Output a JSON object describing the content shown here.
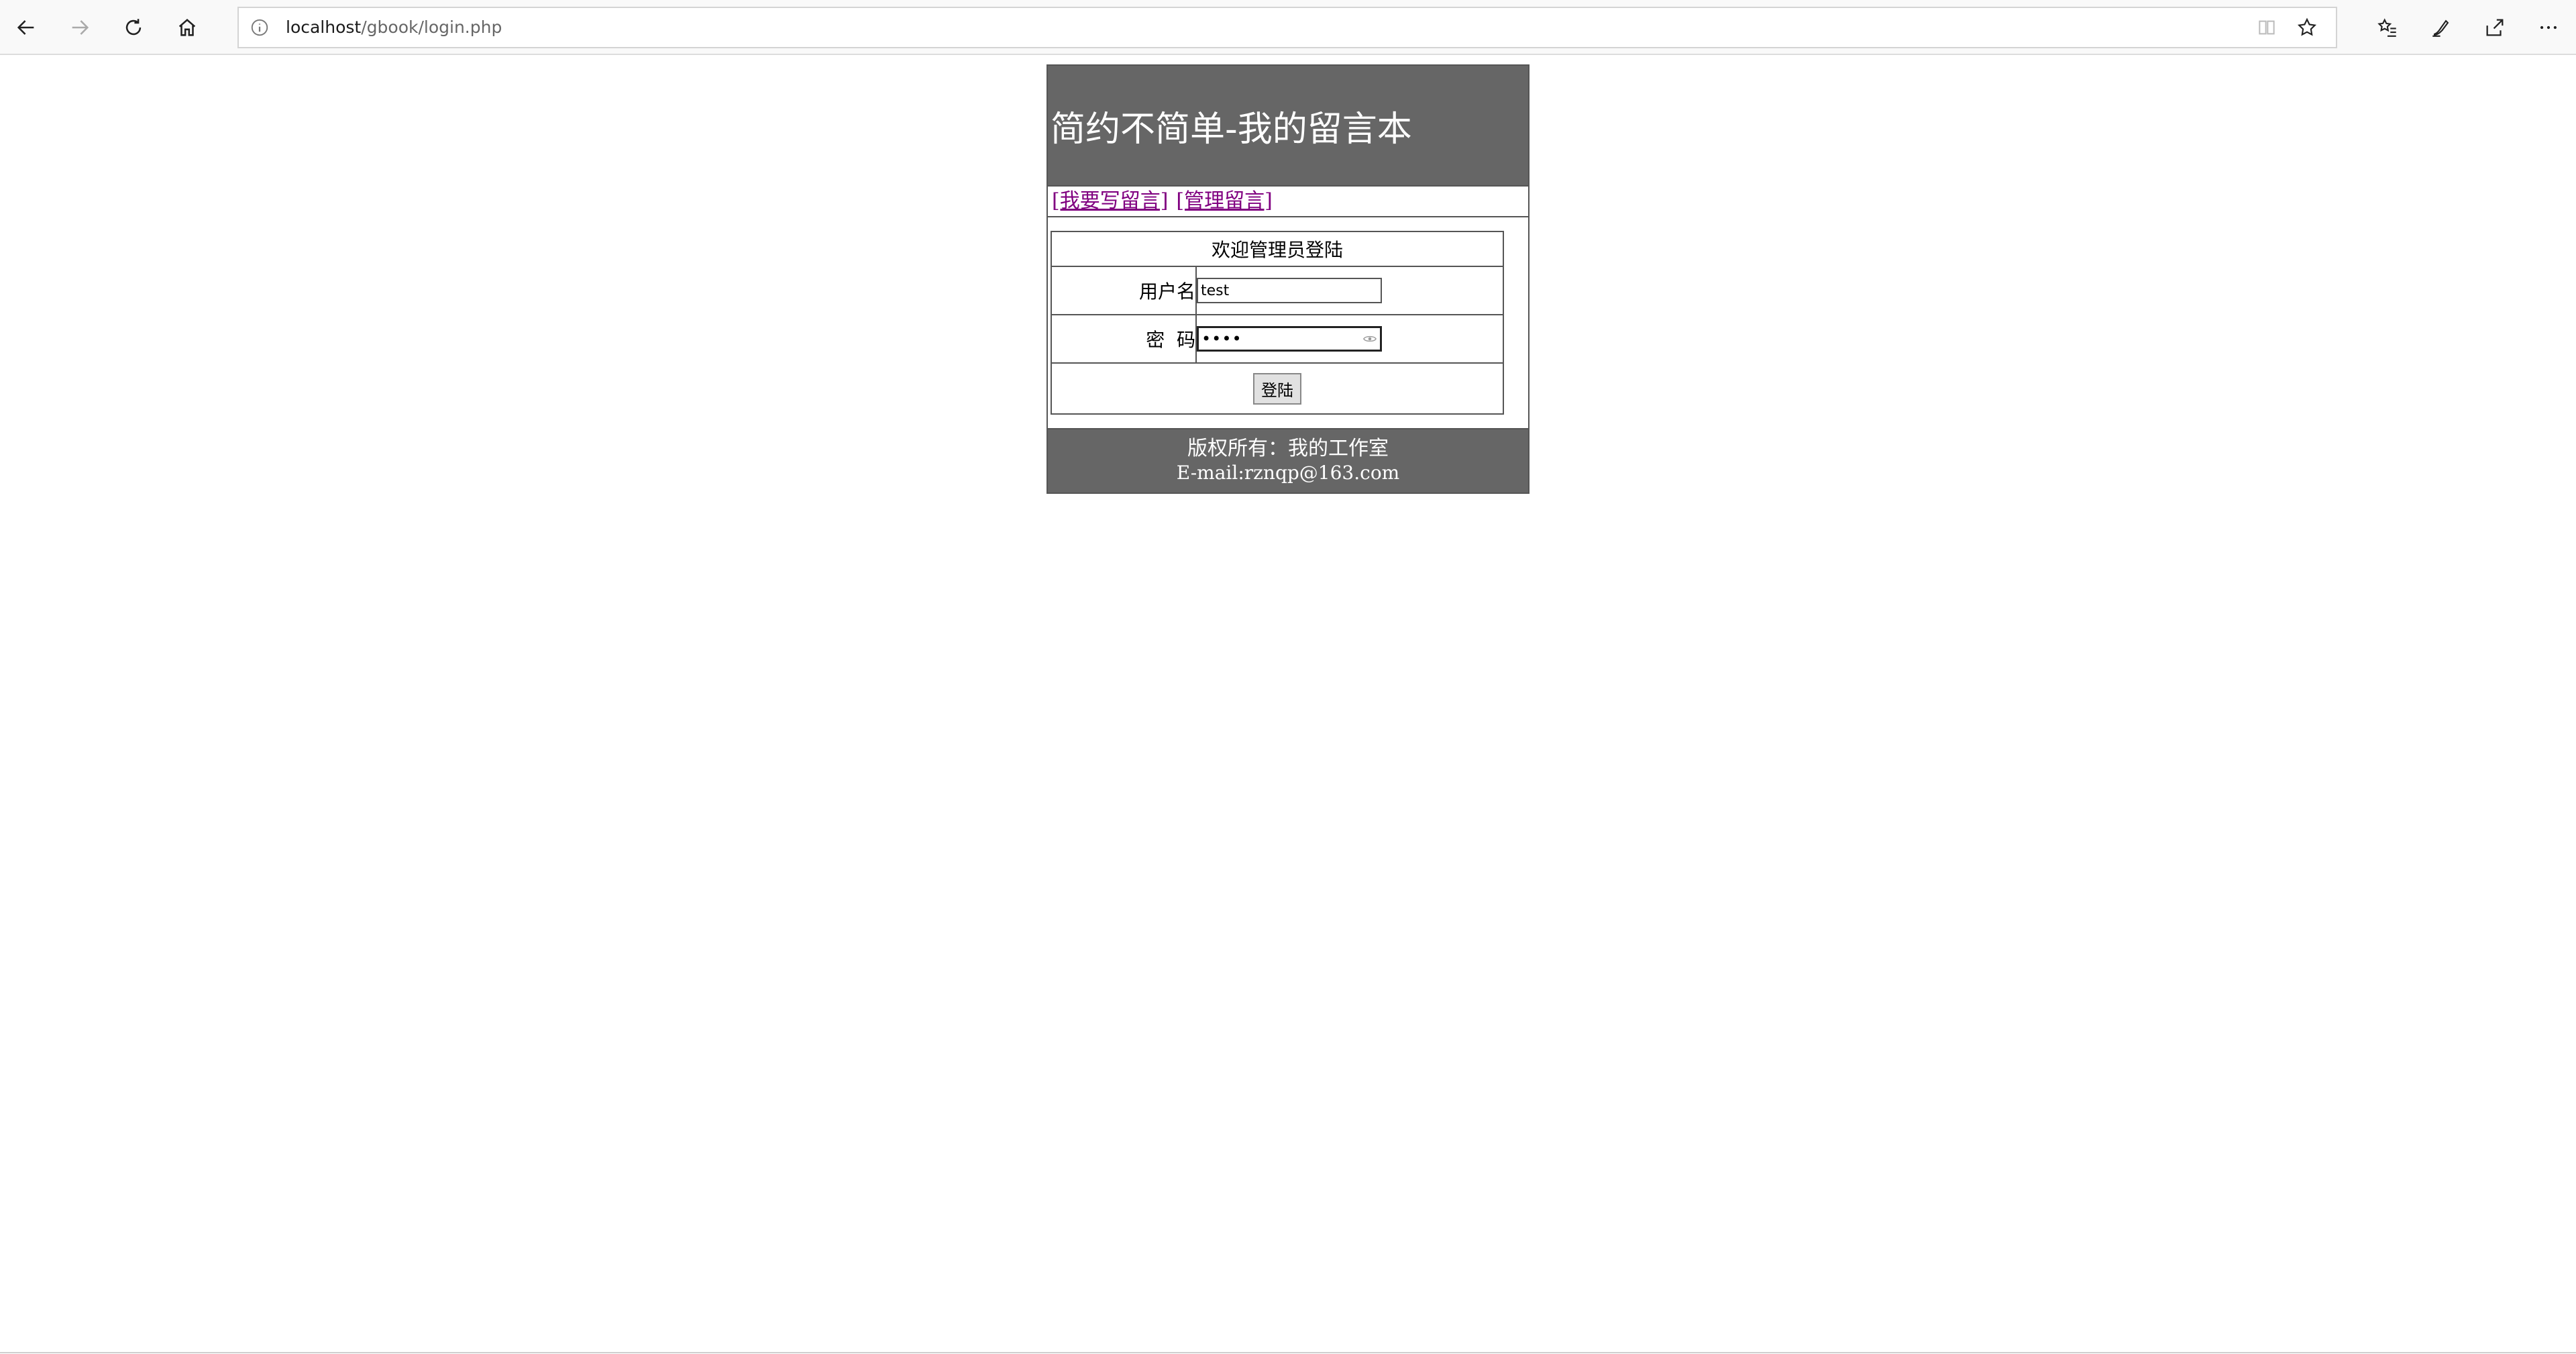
{
  "browser": {
    "url_host": "localhost",
    "url_path": "/gbook/login.php",
    "icons": {
      "back": "back-arrow-icon",
      "forward": "forward-arrow-icon",
      "refresh": "refresh-icon",
      "home": "home-icon",
      "info": "info-icon",
      "reading_view": "reading-view-icon",
      "favorite": "star-icon",
      "favorites_list": "favorites-icon",
      "notes": "pen-icon",
      "share": "share-icon",
      "more": "more-icon"
    }
  },
  "site": {
    "title": "简约不简单-我的留言本",
    "nav": [
      {
        "label": "[我要写留言]"
      },
      {
        "label": "[管理留言]"
      }
    ],
    "colors": {
      "header_bg": "#666666",
      "link": "#800080"
    }
  },
  "login": {
    "heading": "欢迎管理员登陆",
    "username_label": "用户名",
    "username_value": "test",
    "password_label": "密  码",
    "password_value": "••••",
    "submit_label": "登陆"
  },
  "footer": {
    "line1": "版权所有：我的工作室",
    "line2": "E-mail:rznqp@163.com"
  }
}
